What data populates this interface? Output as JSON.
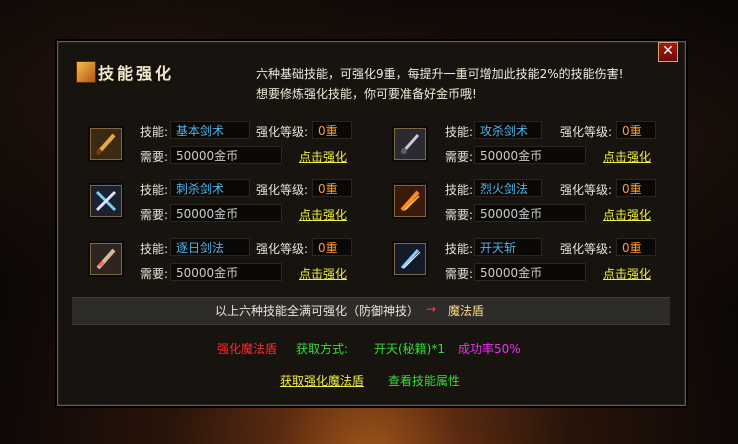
{
  "dialog": {
    "title": "技能强化",
    "close_label": "✕",
    "description_1": "六种基础技能，可强化9重，每提升一重可增加此技能2%的技能伤害!",
    "description_2": "想要修炼强化技能，你可要准备好金币哦!"
  },
  "labels": {
    "skill": "技能:",
    "level": "强化等级:",
    "need": "需要:",
    "enhance_link": "点击强化"
  },
  "skills": [
    {
      "name": "基本剑术",
      "level": "0重",
      "cost": "50000金币",
      "icon": "sword-gold-icon"
    },
    {
      "name": "攻杀剑术",
      "level": "0重",
      "cost": "50000金币",
      "icon": "sword-silver-icon"
    },
    {
      "name": "刺杀剑术",
      "level": "0重",
      "cost": "50000金币",
      "icon": "crossed-swords-blue-icon"
    },
    {
      "name": "烈火剑法",
      "level": "0重",
      "cost": "50000金币",
      "icon": "fire-sword-icon"
    },
    {
      "name": "逐日剑法",
      "level": "0重",
      "cost": "50000金币",
      "icon": "sword-beam-icon"
    },
    {
      "name": "开天斩",
      "level": "0重",
      "cost": "50000金币",
      "icon": "blue-blade-icon"
    }
  ],
  "footer": {
    "combo_text": "以上六种技能全满可强化（防御神技）",
    "arrow": "→",
    "combo_result": "魔法盾",
    "reward_name": "强化魔法盾",
    "method_label": "获取方式:",
    "method_value": "开天(秘籍)*1",
    "success_rate": "成功率50%",
    "get_link": "获取强化魔法盾",
    "view_link": "查看技能属性"
  },
  "colors": {
    "link_yellow": "#f2ee40",
    "skill_blue": "#4fb4e8",
    "level_orange": "#ff9a2e",
    "red": "#ff2a2a",
    "green": "#33dd33",
    "magenta": "#ee33ee"
  }
}
